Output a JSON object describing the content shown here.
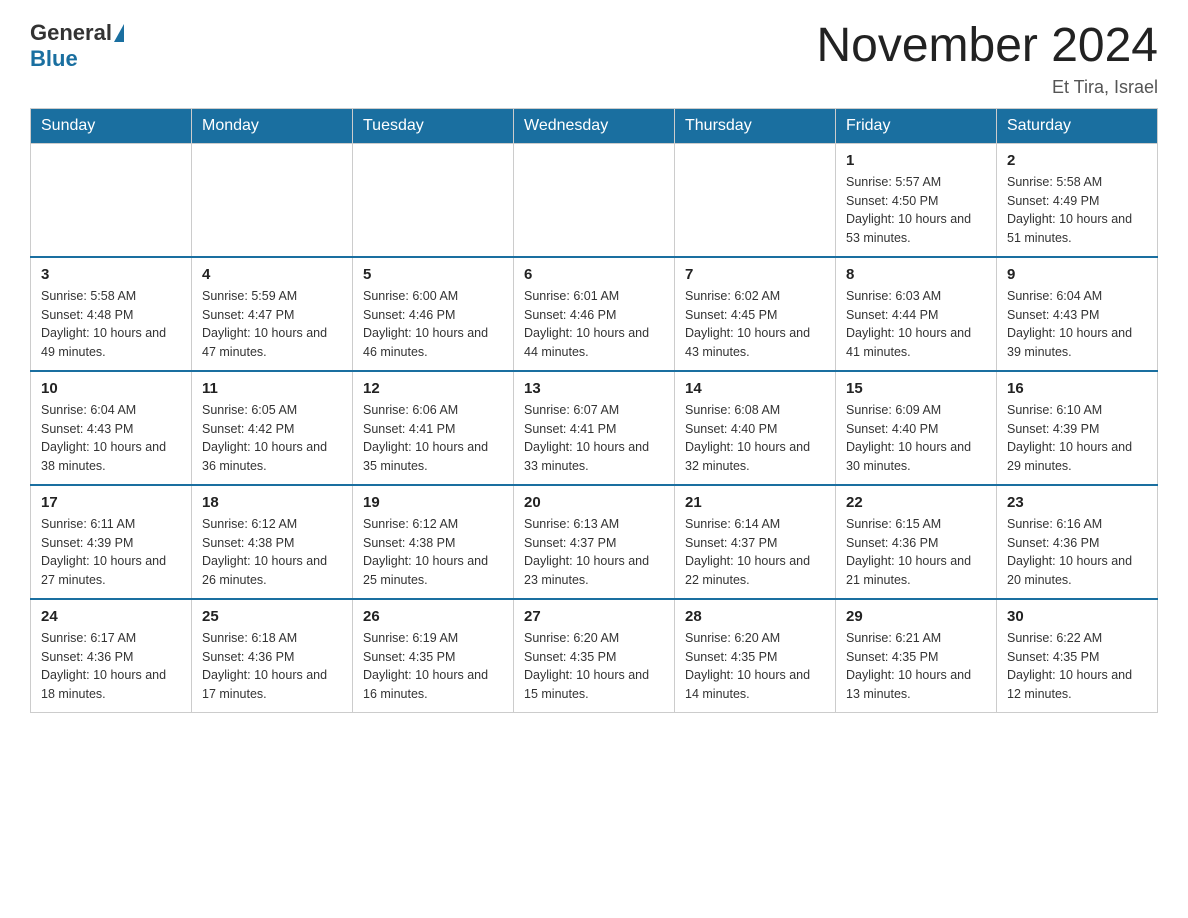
{
  "header": {
    "logo_general": "General",
    "logo_blue": "Blue",
    "month_title": "November 2024",
    "location": "Et Tira, Israel"
  },
  "days_of_week": [
    "Sunday",
    "Monday",
    "Tuesday",
    "Wednesday",
    "Thursday",
    "Friday",
    "Saturday"
  ],
  "weeks": [
    [
      {
        "day": "",
        "info": ""
      },
      {
        "day": "",
        "info": ""
      },
      {
        "day": "",
        "info": ""
      },
      {
        "day": "",
        "info": ""
      },
      {
        "day": "",
        "info": ""
      },
      {
        "day": "1",
        "info": "Sunrise: 5:57 AM\nSunset: 4:50 PM\nDaylight: 10 hours and 53 minutes."
      },
      {
        "day": "2",
        "info": "Sunrise: 5:58 AM\nSunset: 4:49 PM\nDaylight: 10 hours and 51 minutes."
      }
    ],
    [
      {
        "day": "3",
        "info": "Sunrise: 5:58 AM\nSunset: 4:48 PM\nDaylight: 10 hours and 49 minutes."
      },
      {
        "day": "4",
        "info": "Sunrise: 5:59 AM\nSunset: 4:47 PM\nDaylight: 10 hours and 47 minutes."
      },
      {
        "day": "5",
        "info": "Sunrise: 6:00 AM\nSunset: 4:46 PM\nDaylight: 10 hours and 46 minutes."
      },
      {
        "day": "6",
        "info": "Sunrise: 6:01 AM\nSunset: 4:46 PM\nDaylight: 10 hours and 44 minutes."
      },
      {
        "day": "7",
        "info": "Sunrise: 6:02 AM\nSunset: 4:45 PM\nDaylight: 10 hours and 43 minutes."
      },
      {
        "day": "8",
        "info": "Sunrise: 6:03 AM\nSunset: 4:44 PM\nDaylight: 10 hours and 41 minutes."
      },
      {
        "day": "9",
        "info": "Sunrise: 6:04 AM\nSunset: 4:43 PM\nDaylight: 10 hours and 39 minutes."
      }
    ],
    [
      {
        "day": "10",
        "info": "Sunrise: 6:04 AM\nSunset: 4:43 PM\nDaylight: 10 hours and 38 minutes."
      },
      {
        "day": "11",
        "info": "Sunrise: 6:05 AM\nSunset: 4:42 PM\nDaylight: 10 hours and 36 minutes."
      },
      {
        "day": "12",
        "info": "Sunrise: 6:06 AM\nSunset: 4:41 PM\nDaylight: 10 hours and 35 minutes."
      },
      {
        "day": "13",
        "info": "Sunrise: 6:07 AM\nSunset: 4:41 PM\nDaylight: 10 hours and 33 minutes."
      },
      {
        "day": "14",
        "info": "Sunrise: 6:08 AM\nSunset: 4:40 PM\nDaylight: 10 hours and 32 minutes."
      },
      {
        "day": "15",
        "info": "Sunrise: 6:09 AM\nSunset: 4:40 PM\nDaylight: 10 hours and 30 minutes."
      },
      {
        "day": "16",
        "info": "Sunrise: 6:10 AM\nSunset: 4:39 PM\nDaylight: 10 hours and 29 minutes."
      }
    ],
    [
      {
        "day": "17",
        "info": "Sunrise: 6:11 AM\nSunset: 4:39 PM\nDaylight: 10 hours and 27 minutes."
      },
      {
        "day": "18",
        "info": "Sunrise: 6:12 AM\nSunset: 4:38 PM\nDaylight: 10 hours and 26 minutes."
      },
      {
        "day": "19",
        "info": "Sunrise: 6:12 AM\nSunset: 4:38 PM\nDaylight: 10 hours and 25 minutes."
      },
      {
        "day": "20",
        "info": "Sunrise: 6:13 AM\nSunset: 4:37 PM\nDaylight: 10 hours and 23 minutes."
      },
      {
        "day": "21",
        "info": "Sunrise: 6:14 AM\nSunset: 4:37 PM\nDaylight: 10 hours and 22 minutes."
      },
      {
        "day": "22",
        "info": "Sunrise: 6:15 AM\nSunset: 4:36 PM\nDaylight: 10 hours and 21 minutes."
      },
      {
        "day": "23",
        "info": "Sunrise: 6:16 AM\nSunset: 4:36 PM\nDaylight: 10 hours and 20 minutes."
      }
    ],
    [
      {
        "day": "24",
        "info": "Sunrise: 6:17 AM\nSunset: 4:36 PM\nDaylight: 10 hours and 18 minutes."
      },
      {
        "day": "25",
        "info": "Sunrise: 6:18 AM\nSunset: 4:36 PM\nDaylight: 10 hours and 17 minutes."
      },
      {
        "day": "26",
        "info": "Sunrise: 6:19 AM\nSunset: 4:35 PM\nDaylight: 10 hours and 16 minutes."
      },
      {
        "day": "27",
        "info": "Sunrise: 6:20 AM\nSunset: 4:35 PM\nDaylight: 10 hours and 15 minutes."
      },
      {
        "day": "28",
        "info": "Sunrise: 6:20 AM\nSunset: 4:35 PM\nDaylight: 10 hours and 14 minutes."
      },
      {
        "day": "29",
        "info": "Sunrise: 6:21 AM\nSunset: 4:35 PM\nDaylight: 10 hours and 13 minutes."
      },
      {
        "day": "30",
        "info": "Sunrise: 6:22 AM\nSunset: 4:35 PM\nDaylight: 10 hours and 12 minutes."
      }
    ]
  ]
}
